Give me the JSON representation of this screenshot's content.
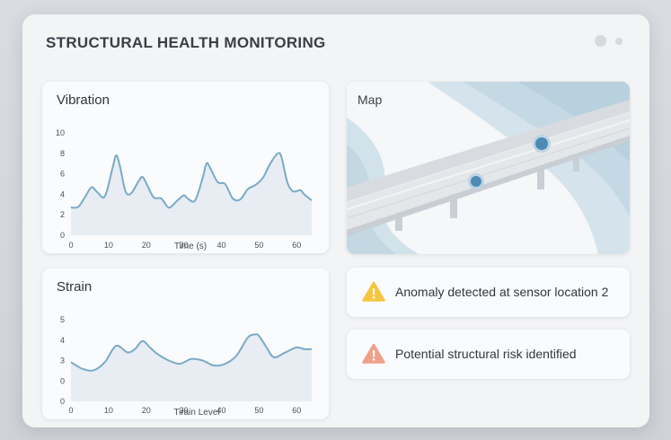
{
  "app": {
    "title": "STRUCTURAL HEALTH MONITORING"
  },
  "charts": {
    "vibration": {
      "title": "Vibration",
      "xlabel": "Time (s)",
      "y_ticks": [
        "10",
        "8",
        "6",
        "4",
        "2",
        "0"
      ],
      "x_ticks": [
        "0",
        "10",
        "20",
        "30",
        "40",
        "50",
        "60"
      ]
    },
    "strain": {
      "title": "Strain",
      "xlabel": "Tirain Level",
      "y_ticks": [
        "5",
        "4",
        "3",
        "0",
        "0"
      ],
      "x_ticks": [
        "0",
        "10",
        "20",
        "30",
        "40",
        "50",
        "60"
      ]
    }
  },
  "chart_data": [
    {
      "type": "line",
      "title": "Vibration",
      "xlabel": "Time (s)",
      "ylabel": "",
      "xlim": [
        0,
        64
      ],
      "ylim": [
        0,
        10
      ],
      "x": [
        0,
        2,
        4,
        5.5,
        7,
        9,
        11,
        12,
        13,
        14.5,
        16,
        18,
        19,
        20,
        22,
        24,
        26,
        28,
        30,
        31,
        33,
        35,
        36,
        37,
        39,
        41,
        43,
        45,
        47,
        49,
        51,
        53,
        55,
        56,
        57.5,
        59,
        61,
        62,
        64
      ],
      "values": [
        2.7,
        2.8,
        3.9,
        4.7,
        4.2,
        3.8,
        6.5,
        7.8,
        6.8,
        4.3,
        4.1,
        5.3,
        5.7,
        5.1,
        3.7,
        3.6,
        2.7,
        3.3,
        3.9,
        3.6,
        3.4,
        5.6,
        7.0,
        6.6,
        5.2,
        5.0,
        3.6,
        3.5,
        4.5,
        4.9,
        5.6,
        7.0,
        8.0,
        7.6,
        5.2,
        4.3,
        4.4,
        4.0,
        3.4
      ]
    },
    {
      "type": "line",
      "title": "Strain",
      "xlabel": "Tirain Level",
      "ylabel": "",
      "xlim": [
        0,
        64
      ],
      "ylim": [
        0,
        5
      ],
      "x": [
        0,
        3,
        6,
        9,
        12,
        15,
        17,
        19,
        21,
        23,
        26,
        29,
        32,
        35,
        38,
        41,
        44,
        47,
        49,
        50,
        52,
        54,
        57,
        60,
        62,
        64
      ],
      "values": [
        2.4,
        2.0,
        1.9,
        2.4,
        3.4,
        3.0,
        3.2,
        3.7,
        3.3,
        2.9,
        2.5,
        2.3,
        2.6,
        2.5,
        2.2,
        2.3,
        2.8,
        3.9,
        4.1,
        4.0,
        3.3,
        2.7,
        3.0,
        3.3,
        3.2,
        3.2
      ]
    }
  ],
  "map": {
    "title": "Map"
  },
  "alerts": [
    {
      "text": "Anomaly detected at sensor location 2",
      "color": "#f5c542",
      "icon": "warning-icon"
    },
    {
      "text": "Potential structural risk identified",
      "color": "#f0a08a",
      "icon": "warning-icon"
    }
  ],
  "colors": {
    "line": "#7aaac8",
    "fill": "#e7edf3",
    "sensor": "#4d8bb4"
  }
}
